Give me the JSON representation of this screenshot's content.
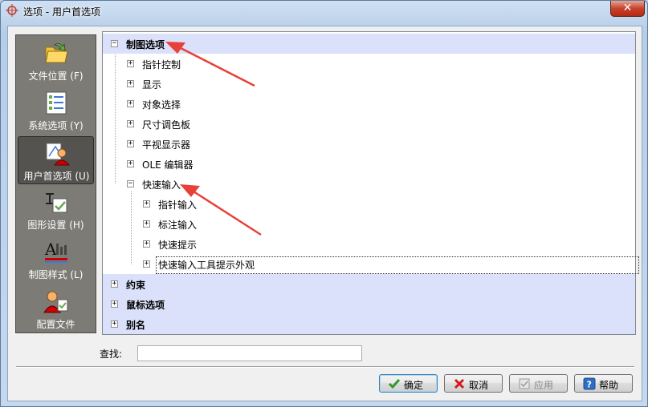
{
  "window": {
    "title": "选项 - 用户首选项",
    "close_label": "✕"
  },
  "nav": {
    "items": [
      {
        "label": "文件位置 (F)",
        "icon": "folder-open-icon"
      },
      {
        "label": "系统选项 (Y)",
        "icon": "checklist-icon"
      },
      {
        "label": "用户首选项 (U)",
        "icon": "user-drawing-icon",
        "selected": true
      },
      {
        "label": "图形设置 (H)",
        "icon": "graphics-settings-icon"
      },
      {
        "label": "制图样式 (L)",
        "icon": "text-style-icon"
      },
      {
        "label": "配置文件",
        "icon": "profile-icon"
      }
    ]
  },
  "tree": {
    "drafting": "制图选项",
    "pointer_control": "指针控制",
    "display": "显示",
    "object_selection": "对象选择",
    "dimension_palette": "尺寸调色板",
    "plan_view": "平视显示器",
    "ole_editor": "OLE 编辑器",
    "quick_input": "快速输入",
    "pointer_input": "指针输入",
    "dimension_input": "标注输入",
    "quick_tip": "快速提示",
    "quick_input_tooltip": "快速输入工具提示外观",
    "constraints": "约束",
    "mouse_options": "鼠标选项",
    "alias": "别名",
    "toggle_expanded": "−",
    "toggle_collapsed": "+"
  },
  "search": {
    "label": "查找:",
    "value": ""
  },
  "buttons": {
    "ok": "确定",
    "cancel": "取消",
    "apply": "应用",
    "help": "帮助"
  },
  "colors": {
    "category_row": "#dbe1fb",
    "nav_background": "#7d7b75",
    "annotation_arrow": "#e8413a"
  }
}
